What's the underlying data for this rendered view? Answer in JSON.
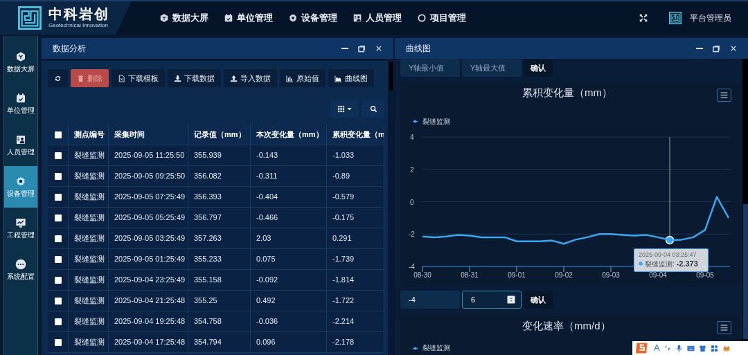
{
  "brand": {
    "name": "中科岩创",
    "subtitle": "Geotechnical Innovation"
  },
  "top_nav": [
    {
      "label": "数据大屏",
      "kind": "cube"
    },
    {
      "label": "单位管理",
      "kind": "calendar"
    },
    {
      "label": "设备管理",
      "kind": "gear"
    },
    {
      "label": "人员管理",
      "kind": "person"
    },
    {
      "label": "项目管理",
      "kind": "ring"
    }
  ],
  "user": {
    "name": "平台管理员"
  },
  "sidebar": {
    "items": [
      {
        "label": "数据大屏",
        "kind": "cube",
        "selected": false
      },
      {
        "label": "单位管理",
        "kind": "calendar",
        "selected": false
      },
      {
        "label": "人员管理",
        "kind": "person",
        "selected": false
      },
      {
        "label": "设备管理",
        "kind": "gear",
        "selected": true
      },
      {
        "label": "工程管理",
        "kind": "chart",
        "selected": false
      },
      {
        "label": "系统配置",
        "kind": "dots",
        "selected": false
      }
    ]
  },
  "data_panel": {
    "title": "数据分析",
    "toolbar": [
      {
        "kind": "refresh"
      },
      {
        "kind": "delete",
        "label": "删除"
      },
      {
        "kind": "template",
        "label": "下载模板"
      },
      {
        "kind": "download",
        "label": "下载数据"
      },
      {
        "kind": "upload",
        "label": "导入数据"
      },
      {
        "kind": "raw",
        "label": "原始值"
      },
      {
        "kind": "curve",
        "label": "曲线图"
      }
    ],
    "table": {
      "select_all_checked": false,
      "columns": [
        "测点编号",
        "采集时间",
        "记录值（mm）",
        "本次变化量（mm）",
        "累积变化量（m"
      ],
      "rows": [
        {
          "checked": false,
          "cells": [
            "裂缝监测",
            "2025-09-05 11:25:50",
            "355.939",
            "-0.143",
            "-1.033"
          ]
        },
        {
          "checked": false,
          "cells": [
            "裂缝监测",
            "2025-09-05 09:25:50",
            "356.082",
            "-0.311",
            "-0.89"
          ]
        },
        {
          "checked": false,
          "cells": [
            "裂缝监测",
            "2025-09-05 07:25:49",
            "356.393",
            "-0.404",
            "-0.579"
          ]
        },
        {
          "checked": false,
          "cells": [
            "裂缝监测",
            "2025-09-05 05:25:49",
            "356.797",
            "-0.466",
            "-0.175"
          ]
        },
        {
          "checked": false,
          "cells": [
            "裂缝监测",
            "2025-09-05 03:25:49",
            "357.263",
            "2.03",
            "0.291"
          ]
        },
        {
          "checked": false,
          "cells": [
            "裂缝监测",
            "2025-09-05 01:25:49",
            "355.233",
            "0.075",
            "-1.739"
          ]
        },
        {
          "checked": false,
          "cells": [
            "裂缝监测",
            "2025-09-04 23:25:49",
            "355.158",
            "-0.092",
            "-1.814"
          ]
        },
        {
          "checked": false,
          "cells": [
            "裂缝监测",
            "2025-09-04 21:25:48",
            "355.25",
            "0.492",
            "-1.722"
          ]
        },
        {
          "checked": false,
          "cells": [
            "裂缝监测",
            "2025-09-04 19:25:48",
            "354.758",
            "-0.036",
            "-2.214"
          ]
        },
        {
          "checked": false,
          "cells": [
            "裂缝监测",
            "2025-09-04 17:25:48",
            "354.794",
            "0.096",
            "-2.178"
          ]
        }
      ]
    }
  },
  "curve_panel": {
    "title": "曲线图",
    "range_top": {
      "min_placeholder": "Y轴最小值",
      "max_placeholder": "Y轴最大值",
      "confirm": "确认"
    },
    "chart1": {
      "chart_data": {
        "type": "line",
        "title": "累积变化量（mm）",
        "categories": [
          "08-30",
          null,
          null,
          null,
          "08-31",
          null,
          null,
          null,
          "09-01",
          null,
          null,
          null,
          "09-02",
          null,
          null,
          null,
          "09-03",
          null,
          null,
          null,
          "09-04",
          null,
          null,
          null,
          "09-05",
          null,
          null
        ],
        "series": [
          {
            "name": "裂缝监测",
            "color": "#3aa8f0",
            "values": [
              -2.15,
              -2.2,
              -2.15,
              -2.05,
              -2.1,
              -2.2,
              -2.2,
              -2.2,
              -2.45,
              -2.45,
              -2.45,
              -2.4,
              -2.6,
              -2.35,
              -2.2,
              -2.0,
              -2.0,
              -2.05,
              -2.1,
              -2.05,
              -2.2,
              -2.37,
              -2.35,
              -2.2,
              -1.75,
              0.3,
              -1.0
            ]
          }
        ],
        "ylim": [
          -4,
          4
        ],
        "yticks": [
          -4,
          -2,
          0,
          2,
          4
        ],
        "grid": true
      },
      "tooltip": {
        "time": "2025-09-04 03:25:47",
        "series": "裂缝监测: ",
        "value": "-2.373"
      }
    },
    "range_bottom": {
      "min_value": "-4",
      "max_value": "6",
      "confirm": "确认"
    },
    "chart2": {
      "title": "变化速率（mm/d）",
      "legend": "裂缝监测"
    }
  },
  "ime_toolbar": {
    "label": "A"
  }
}
